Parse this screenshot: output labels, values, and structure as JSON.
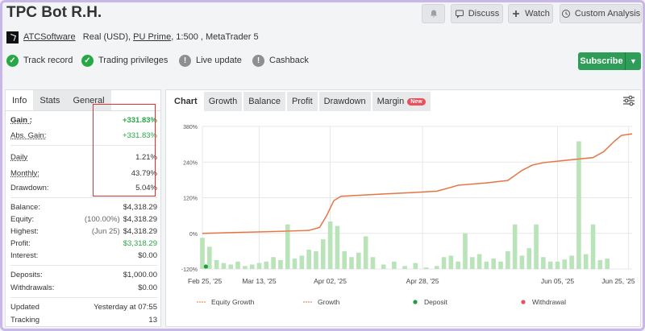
{
  "header": {
    "title": "TPC Bot R.H.",
    "discuss": "Discuss",
    "watch": "Watch",
    "custom_analysis": "Custom Analysis"
  },
  "meta": {
    "author": "ATCSoftware",
    "account": "Real (USD),",
    "broker": "PU Prime",
    "details": ", 1:500 , MetaTrader 5"
  },
  "badges": [
    {
      "label": "Track record",
      "status": "ok"
    },
    {
      "label": "Trading privileges",
      "status": "ok"
    },
    {
      "label": "Live update",
      "status": "neutral"
    },
    {
      "label": "Cashback",
      "status": "neutral"
    }
  ],
  "subscribe": "Subscribe",
  "left_tabs": [
    "Info",
    "Stats",
    "General"
  ],
  "stats": {
    "gain": {
      "label": "Gain :",
      "value": "+331.83%"
    },
    "abs_gain": {
      "label": "Abs. Gain:",
      "value": "+331.83%"
    },
    "daily": {
      "label": "Daily",
      "value": "1.21%"
    },
    "monthly": {
      "label": "Monthly:",
      "value": "43.79%"
    },
    "drawdown": {
      "label": "Drawdown:",
      "value": "5.04%"
    },
    "balance": {
      "label": "Balance:",
      "value": "$4,318.29"
    },
    "equity": {
      "label": "Equity:",
      "prefix": "(100.00%)",
      "value": "$4,318.29"
    },
    "highest": {
      "label": "Highest:",
      "prefix": "(Jun 25)",
      "value": "$4,318.29"
    },
    "profit": {
      "label": "Profit:",
      "value": "$3,318.29"
    },
    "interest": {
      "label": "Interest:",
      "value": "$0.00"
    },
    "deposits": {
      "label": "Deposits:",
      "value": "$1,000.00"
    },
    "withdrawals": {
      "label": "Withdrawals:",
      "value": "$0.00"
    },
    "updated": {
      "label": "Updated",
      "value": "Yesterday at 07:55"
    },
    "tracking": {
      "label": "Tracking",
      "value": "13"
    }
  },
  "chart_tabs": [
    "Chart",
    "Growth",
    "Balance",
    "Profit",
    "Drawdown",
    "Margin"
  ],
  "new_tag": "New",
  "chart_data": {
    "type": "line",
    "y_ticks": [
      "380%",
      "240%",
      "120%",
      "0%",
      "-120%"
    ],
    "y_tick_values": [
      360,
      240,
      120,
      0,
      -120
    ],
    "ylim": [
      -120,
      360
    ],
    "x_tick_labels": [
      "Feb 25, '25",
      "Mar 13, '25",
      "Apr 02, '25",
      "Apr 28, '25",
      "Jun 05, '25",
      "Jun 25, '25"
    ],
    "x_range": [
      0,
      121
    ],
    "x_tick_days": [
      0,
      16,
      36,
      62,
      100,
      120
    ],
    "colors": {
      "equity": "#f2b48a",
      "growth": "#e07048",
      "bars": "#b9e3b8",
      "deposit": "#1e9e3e",
      "withdrawal": "#e8505b",
      "grid": "#e7e7e7"
    },
    "legend": [
      "Equity Growth",
      "Growth",
      "Deposit",
      "Withdrawal"
    ],
    "growth_points": [
      [
        0,
        0
      ],
      [
        10,
        3
      ],
      [
        20,
        6
      ],
      [
        30,
        10
      ],
      [
        33,
        20
      ],
      [
        35,
        60
      ],
      [
        37,
        110
      ],
      [
        39,
        125
      ],
      [
        50,
        132
      ],
      [
        60,
        138
      ],
      [
        66,
        142
      ],
      [
        70,
        155
      ],
      [
        72,
        162
      ],
      [
        80,
        170
      ],
      [
        86,
        178
      ],
      [
        88,
        195
      ],
      [
        90,
        212
      ],
      [
        93,
        230
      ],
      [
        96,
        238
      ],
      [
        104,
        248
      ],
      [
        110,
        255
      ],
      [
        113,
        275
      ],
      [
        116,
        310
      ],
      [
        118,
        330
      ],
      [
        121,
        335
      ]
    ],
    "bars": [
      [
        0,
        -15
      ],
      [
        2,
        -45
      ],
      [
        4,
        -90
      ],
      [
        6,
        -100
      ],
      [
        8,
        -105
      ],
      [
        10,
        -95
      ],
      [
        12,
        -110
      ],
      [
        14,
        -105
      ],
      [
        16,
        -100
      ],
      [
        18,
        -95
      ],
      [
        20,
        -80
      ],
      [
        22,
        -90
      ],
      [
        24,
        30
      ],
      [
        26,
        -85
      ],
      [
        28,
        -75
      ],
      [
        30,
        -55
      ],
      [
        32,
        -60
      ],
      [
        34,
        -20
      ],
      [
        36,
        40
      ],
      [
        38,
        25
      ],
      [
        40,
        -60
      ],
      [
        42,
        -80
      ],
      [
        44,
        -65
      ],
      [
        46,
        -10
      ],
      [
        48,
        -80
      ],
      [
        51,
        -105
      ],
      [
        54,
        -95
      ],
      [
        57,
        -110
      ],
      [
        60,
        -100
      ],
      [
        63,
        -115
      ],
      [
        66,
        -110
      ],
      [
        68,
        -80
      ],
      [
        70,
        -75
      ],
      [
        72,
        -95
      ],
      [
        74,
        0
      ],
      [
        76,
        -80
      ],
      [
        78,
        -70
      ],
      [
        80,
        -95
      ],
      [
        82,
        -85
      ],
      [
        84,
        -95
      ],
      [
        86,
        -60
      ],
      [
        88,
        30
      ],
      [
        90,
        -75
      ],
      [
        92,
        -50
      ],
      [
        94,
        30
      ],
      [
        96,
        -80
      ],
      [
        98,
        -95
      ],
      [
        100,
        -95
      ],
      [
        102,
        -88
      ],
      [
        104,
        -75
      ],
      [
        106,
        310
      ],
      [
        108,
        -70
      ],
      [
        110,
        30
      ],
      [
        112,
        -90
      ],
      [
        114,
        -85
      ]
    ],
    "deposit_points": [
      [
        1,
        -120
      ]
    ]
  }
}
